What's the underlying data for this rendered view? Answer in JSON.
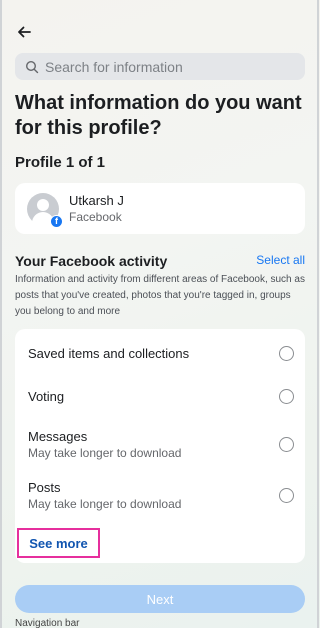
{
  "header": {
    "back_icon": "arrow-left-icon"
  },
  "search": {
    "placeholder": "Search for information",
    "value": "",
    "icon": "search-icon"
  },
  "page": {
    "title": "What information do you want for this profile?",
    "profile_count": "Profile 1 of 1"
  },
  "profile": {
    "name": "Utkarsh J",
    "platform": "Facebook",
    "badge_letter": "f"
  },
  "section": {
    "heading": "Your Facebook activity",
    "select_all": "Select all",
    "description": "Information and activity from different areas of Facebook, such as posts that you've created, photos that you're tagged in, groups you belong to and more"
  },
  "items": [
    {
      "label": "Saved items and collections",
      "sub": "",
      "selected": false
    },
    {
      "label": "Voting",
      "sub": "",
      "selected": false
    },
    {
      "label": "Messages",
      "sub": "May take longer to download",
      "selected": false
    },
    {
      "label": "Posts",
      "sub": "May take longer to download",
      "selected": false
    }
  ],
  "see_more": "See more",
  "footer": {
    "next": "Next",
    "hint": "Navigation bar"
  },
  "colors": {
    "accent": "#1877f2",
    "next_disabled": "#a9cdf5",
    "highlight": "#e62f9d"
  }
}
